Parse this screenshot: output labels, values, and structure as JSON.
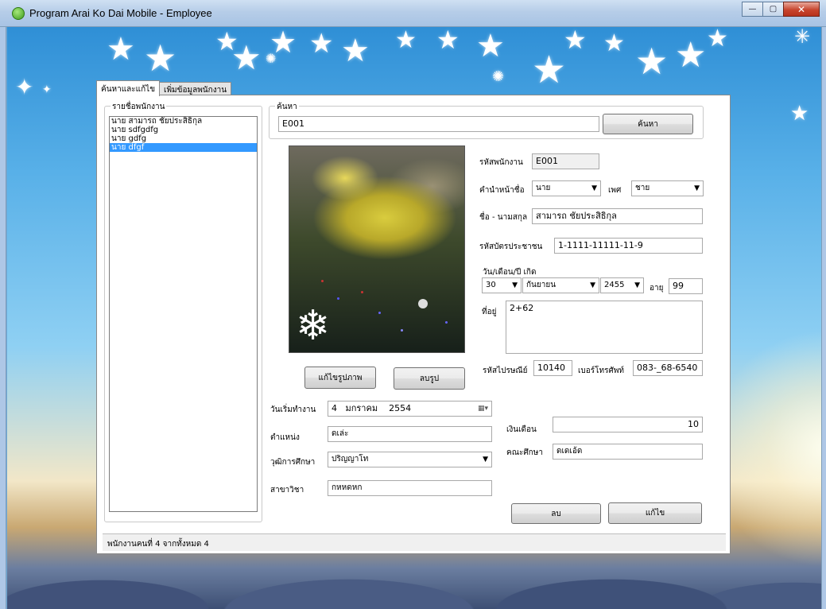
{
  "window": {
    "title": "Program Arai Ko Dai Mobile - Employee",
    "minimize": "—",
    "maximize": "▢",
    "close": "✕"
  },
  "tabs": [
    {
      "label": "ค้นหาและแก้ไข",
      "active": true
    },
    {
      "label": "เพิ่มข้อมูลพนักงาน",
      "active": false
    }
  ],
  "employee_list": {
    "group_label": "รายชื่อพนักงาน",
    "items": [
      "นาย สามารถ ชัยประสิธิกุล",
      "นาย sdfgdfg",
      "นาย gdfg",
      "นาย dfgf"
    ],
    "selected_index": 3
  },
  "search": {
    "group_label": "ค้นหา",
    "value": "E001",
    "button_label": "ค้นหา"
  },
  "form": {
    "employee_id_label": "รหัสพนักงาน",
    "employee_id": "E001",
    "prefix_label": "คำนำหน้าชื่อ",
    "prefix": "นาย",
    "gender_label": "เพศ",
    "gender": "ชาย",
    "name_label": "ชื่อ - นามสกุล",
    "name": "สามารถ ชัยประสิธิกุล",
    "id_card_label": "รหัสบัตรประชาชน",
    "id_card": "1-1111-11111-11-9",
    "birthdate_label": "วัน/เดือน/ปี เกิด",
    "birth_day": "30",
    "birth_month": "กันยายน",
    "birth_year": "2455",
    "age_label": "อายุ",
    "age": "99",
    "address_label": "ที่อยู่",
    "address": "2+62",
    "postcode_label": "รหัสไปรษณีย์",
    "postcode": "10140",
    "phone_label": "เบอร์โทรศัพท์",
    "phone": "083-_68-6540",
    "start_date_label": "วันเริ่มทำงาน",
    "start_date": "4   มกราคม    2554",
    "position_label": "ตำแหน่ง",
    "position": "ดเล่ะ",
    "education_label": "วุฒิการศึกษา",
    "education": "ปริญญาโท",
    "major_label": "สาขาวิชา",
    "major": "กหหดหก",
    "salary_label": "เงินเดือน",
    "salary": "10",
    "faculty_label": "คณะศึกษา",
    "faculty": "ดเดเอ้ด"
  },
  "buttons": {
    "edit_photo": "แก้ไขรูปภาพ",
    "delete_photo": "ลบรูป",
    "delete": "ลบ",
    "edit": "แก้ไข"
  },
  "status": {
    "text": "พนักงานคนที่  4 จากทั้งหมด 4"
  },
  "icons": {
    "dropdown": "▼",
    "calendar": "▦▾"
  }
}
